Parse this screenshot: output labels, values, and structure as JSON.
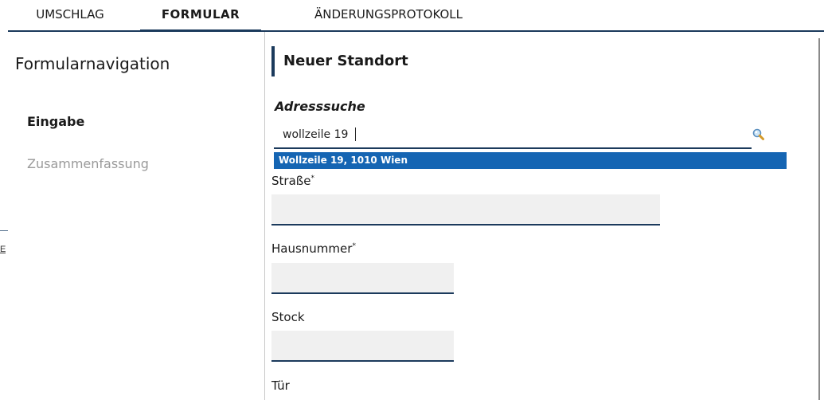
{
  "tabs": [
    {
      "label": "UMSCHLAG"
    },
    {
      "label": "FORMULAR"
    },
    {
      "label": "ÄNDERUNGSPROTOKOLL"
    }
  ],
  "edge": {
    "text": "E"
  },
  "nav": {
    "title": "Formularnavigation",
    "items": [
      {
        "label": "Eingabe"
      },
      {
        "label": "Zusammenfassung"
      }
    ]
  },
  "section": {
    "title": "Neuer Standort"
  },
  "search": {
    "label": "Adresssuche",
    "value": "wollzeile 19",
    "suggestion": "Wollzeile 19, 1010 Wien"
  },
  "fields": {
    "strasse": {
      "label": "Straße",
      "required": "*"
    },
    "hausnummer": {
      "label": "Hausnummer",
      "required": "*"
    },
    "stock": {
      "label": "Stock"
    },
    "tuer": {
      "label": "Tür"
    }
  },
  "colors": {
    "accent": "#1b3a5c",
    "suggestion_bg": "#1565b3",
    "field_bg": "#f0f0f0"
  }
}
